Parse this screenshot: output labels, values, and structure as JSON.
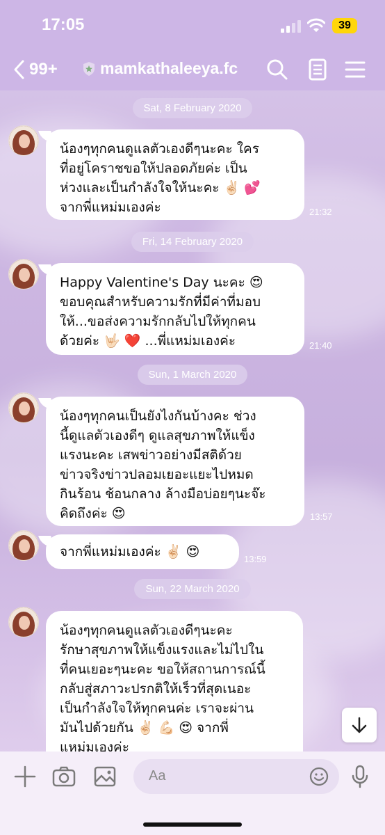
{
  "status": {
    "time": "17:05",
    "battery": "39"
  },
  "nav": {
    "back_count": "99+",
    "title": "mamkathaleeya.fc"
  },
  "dates": [
    "Sat, 8 February 2020",
    "Fri, 14 February 2020",
    "Sun, 1 March 2020",
    "Sun, 22 March 2020"
  ],
  "messages": [
    {
      "lines": [
        "น้องๆทุกคนดูแลตัวเองดีๆนะคะ ใคร",
        "ที่อยู่โคราชขอให้ปลอดภัยค่ะ เป็น",
        "ห่วงและเป็นกำลังใจให้นะคะ ✌🏻 💕",
        "จากพี่แหม่มเองค่ะ"
      ],
      "time": "21:32"
    },
    {
      "lines": [
        "Happy Valentine's Day นะคะ 😍",
        "ขอบคุณสำหรับความรักที่มีค่าที่มอบ",
        "ให้...ขอส่งความรักกลับไปให้ทุกคน",
        "ด้วยค่ะ 🤟🏻 ❤️ ...พี่แหม่มเองค่ะ"
      ],
      "time": "21:40"
    },
    {
      "lines": [
        "น้องๆทุกคนเป็นยังไงกันบ้างคะ ช่วง",
        "นี้ดูแลตัวเองดีๆ ดูแลสุขภาพให้แข็ง",
        "แรงนะคะ เสพข่าวอย่างมีสติด้วย",
        "ข่าวจริงข่าวปลอมเยอะแยะไปหมด",
        "กินร้อน ช้อนกลาง ล้างมือบ่อยๆนะจ๊ะ",
        "คิดถึงค่ะ 😍"
      ],
      "time": "13:57"
    },
    {
      "lines": [
        "จากพี่แหม่มเองค่ะ ✌🏻 😍"
      ],
      "time": "13:59"
    },
    {
      "lines": [
        "น้องๆทุกคนดูแลตัวเองดีๆนะคะ",
        "รักษาสุขภาพให้แข็งแรงและไม่ไปใน",
        "ที่คนเยอะๆนะคะ ขอให้สถานการณ์นี้",
        "กลับสู่สภาวะปรกติให้เร็วที่สุดเนอะ",
        "เป็นกำลังใจให้ทุกคนค่ะ เราจะผ่าน",
        "มันไปด้วยกัน ✌🏻 💪🏻 😍 จากพี่",
        "แหม่มเองค่ะ"
      ],
      "time": ""
    }
  ],
  "input": {
    "placeholder": "Aa"
  },
  "icons": [
    "chevron-left-icon",
    "star-badge-icon",
    "search-icon",
    "notes-icon",
    "menu-icon",
    "plus-icon",
    "camera-icon",
    "image-icon",
    "emoji-icon",
    "microphone-icon",
    "arrow-down-icon"
  ],
  "colors": {
    "header": "#cdb6e6",
    "bubble": "#ffffff",
    "battery": "#ffd60a"
  }
}
